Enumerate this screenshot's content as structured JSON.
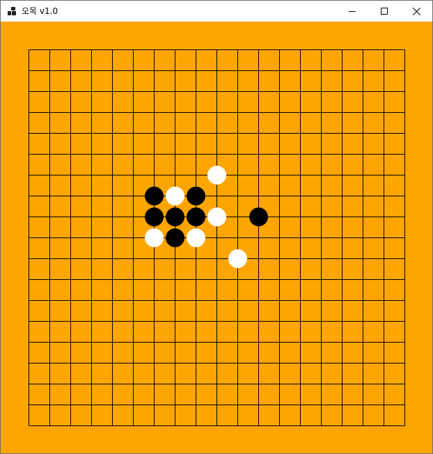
{
  "window": {
    "title": "오목 v1.0",
    "icons": {
      "app": "app-icon",
      "minimize": "minimize-icon",
      "maximize": "maximize-icon",
      "close": "close-icon"
    }
  },
  "colors": {
    "board": "#ffa500",
    "grid_line": "#000000",
    "black_stone": "#000000",
    "white_stone": "#ffffff"
  },
  "board": {
    "lines": 19,
    "stones": [
      {
        "color": "white",
        "col": 9,
        "row": 6
      },
      {
        "color": "black",
        "col": 6,
        "row": 7
      },
      {
        "color": "white",
        "col": 7,
        "row": 7
      },
      {
        "color": "black",
        "col": 8,
        "row": 7
      },
      {
        "color": "black",
        "col": 6,
        "row": 8
      },
      {
        "color": "black",
        "col": 7,
        "row": 8
      },
      {
        "color": "black",
        "col": 8,
        "row": 8
      },
      {
        "color": "white",
        "col": 9,
        "row": 8
      },
      {
        "color": "black",
        "col": 11,
        "row": 8
      },
      {
        "color": "white",
        "col": 6,
        "row": 9
      },
      {
        "color": "black",
        "col": 7,
        "row": 9
      },
      {
        "color": "white",
        "col": 8,
        "row": 9
      },
      {
        "color": "white",
        "col": 10,
        "row": 10
      }
    ]
  }
}
